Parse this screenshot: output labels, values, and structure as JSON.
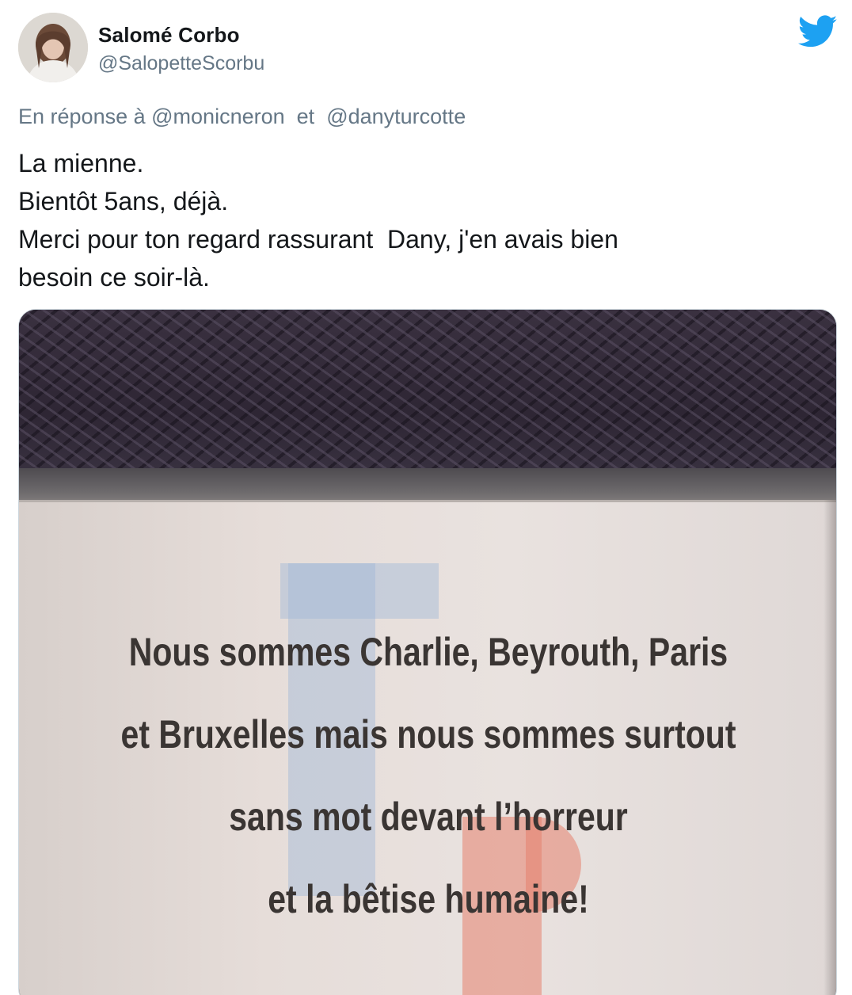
{
  "author": {
    "display_name": "Salomé Corbo",
    "handle": "@SalopetteScorbu"
  },
  "icons": {
    "avatar": "avatar",
    "brand": "twitter-bird-icon",
    "brand_color": "#1da1f2"
  },
  "reply": {
    "prefix": "En réponse à",
    "mention_1": "@monicneron",
    "conjunction": "et",
    "mention_2": "@danyturcotte"
  },
  "tweet": {
    "lines": [
      "La mienne.",
      "Bientôt 5ans, déjà.",
      "Merci pour ton regard rassurant  Dany, j'en avais bien",
      "besoin ce soir-là."
    ]
  },
  "media": {
    "card_lines": [
      "Nous sommes Charlie, Beyrouth, Paris",
      "et Bruxelles mais nous sommes surtout",
      "sans mot devant l’horreur",
      "et la bêtise humaine!"
    ]
  }
}
